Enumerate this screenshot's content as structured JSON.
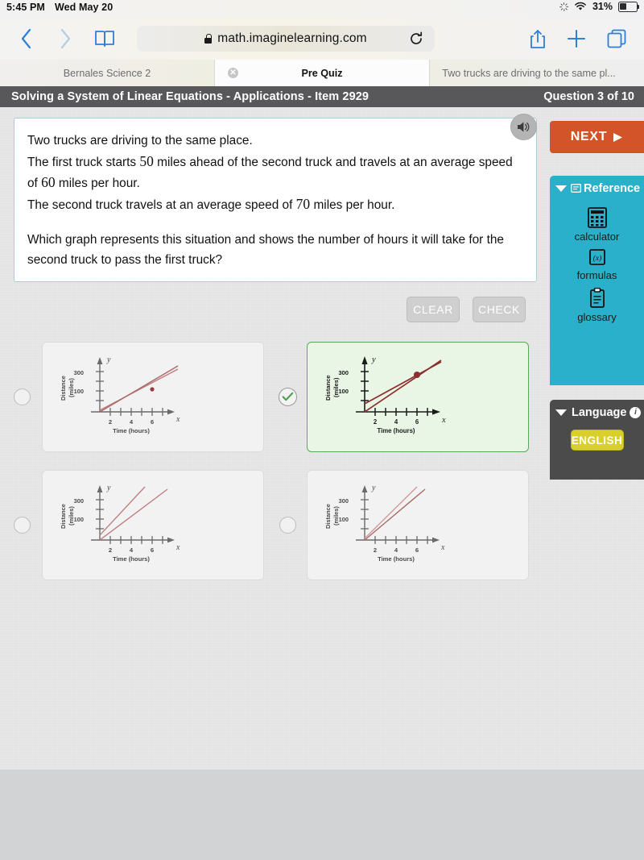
{
  "statusbar": {
    "time": "5:45 PM",
    "date": "Wed May 20",
    "battery_percent": "31%",
    "wifi_icon": "wifi-icon",
    "sync_icon": "sync-spinner-icon",
    "battery_icon": "battery-icon"
  },
  "browser": {
    "back_icon": "back-chevron-icon",
    "forward_icon": "forward-chevron-icon",
    "bookmarks_icon": "book-icon",
    "lock_icon": "lock-icon",
    "url": "math.imaginelearning.com",
    "reload_icon": "reload-icon",
    "share_icon": "share-icon",
    "newtab_icon": "plus-icon",
    "tabs_icon": "tabs-icon",
    "tabs": [
      {
        "label": "Bernales Science 2",
        "active": false,
        "closable": false
      },
      {
        "label": "Pre Quiz",
        "active": true,
        "closable": true
      },
      {
        "label": "Two trucks are driving to the same pl...",
        "active": false,
        "closable": false
      }
    ]
  },
  "app_header": {
    "title": "Solving a System of Linear Equations - Applications - Item 2929",
    "question_counter": "Question 3 of 10"
  },
  "question": {
    "speaker_icon": "speaker-icon",
    "line1_a": "Two trucks are driving to the same place.",
    "line2_a": "The first truck starts ",
    "line2_n": "50",
    "line2_b": " miles ahead of the second truck and travels at an average speed of ",
    "line2_n2": "60",
    "line2_c": " miles per hour.",
    "line3_a": "The second truck travels at an average speed of ",
    "line3_n": "70",
    "line3_b": " miles per hour.",
    "line4": "Which graph represents this situation and shows the number of hours it will take for the second truck to pass the first truck?"
  },
  "actions": {
    "clear_label": "CLEAR",
    "check_label": "CHECK"
  },
  "choices": [
    {
      "id": "choice-a",
      "selected": false,
      "marker": "radio",
      "graph": {
        "xlabel": "Time (hours)",
        "ylabel_1": "Distance",
        "ylabel_2": "(miles)",
        "x_axis_letter": "x",
        "y_axis_letter": "y",
        "xticks": [
          "2",
          "4",
          "6"
        ],
        "yticks": [
          "100",
          "300"
        ],
        "intersection_label": ""
      }
    },
    {
      "id": "choice-b",
      "selected": true,
      "marker": "checkmark",
      "graph": {
        "xlabel": "Time (hours)",
        "ylabel_1": "Distance",
        "ylabel_2": "(miles)",
        "x_axis_letter": "x",
        "y_axis_letter": "y",
        "xticks": [
          "2",
          "4",
          "6"
        ],
        "yticks": [
          "100",
          "300"
        ],
        "intersection_label": ""
      }
    },
    {
      "id": "choice-c",
      "selected": false,
      "marker": "radio",
      "graph": {
        "xlabel": "Time (hours)",
        "ylabel_1": "Distance",
        "ylabel_2": "(miles)",
        "x_axis_letter": "x",
        "y_axis_letter": "y",
        "xticks": [
          "2",
          "4",
          "6"
        ],
        "yticks": [
          "100",
          "300"
        ],
        "intersection_label": ""
      }
    },
    {
      "id": "choice-d",
      "selected": false,
      "marker": "radio",
      "graph": {
        "xlabel": "Time (hours)",
        "ylabel_1": "Distance",
        "ylabel_2": "(miles)",
        "x_axis_letter": "x",
        "y_axis_letter": "y",
        "xticks": [
          "2",
          "4",
          "6"
        ],
        "yticks": [
          "100",
          "300"
        ],
        "intersection_label": ""
      }
    }
  ],
  "rail": {
    "next_label": "NEXT",
    "next_icon": "play-triangle-icon",
    "reference_label": "Reference",
    "reference_caret": "caret-down-icon",
    "reference_badge_icon": "reference-card-icon",
    "tools": [
      {
        "label": "calculator",
        "icon": "calculator-icon"
      },
      {
        "label": "formulas",
        "icon": "formulas-icon"
      },
      {
        "label": "glossary",
        "icon": "clipboard-icon"
      }
    ],
    "language_label": "Language",
    "language_caret": "caret-down-icon",
    "language_info_icon": "info-icon",
    "language_value": "ENGLISH"
  },
  "colors": {
    "accent_orange": "#d4542a",
    "reference_teal": "#2ab0cb",
    "language_gray": "#4b4b4b",
    "english_yellow": "#d8cf2c",
    "header_gray": "#58585a",
    "selected_green_border": "#5aa95a",
    "selected_green_bg": "#e9f6e6",
    "graph_line": "#c08a8a",
    "graph_line_dark": "#8e2f2f"
  }
}
